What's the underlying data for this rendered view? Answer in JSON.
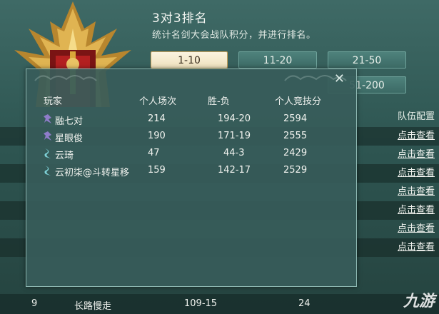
{
  "header": {
    "title": "3对3排名",
    "subtitle": "统计名剑大会战队积分，并进行排名。"
  },
  "range_tabs": [
    {
      "label": "1-10",
      "active": true
    },
    {
      "label": "11-20",
      "active": false
    },
    {
      "label": "21-50",
      "active": false
    },
    {
      "label": "51-200",
      "active": false
    }
  ],
  "background_list": {
    "column_label": "队伍配置",
    "link_label": "点击查看",
    "bottom_row": {
      "rank": "9",
      "team": "长路慢走",
      "record": "109-15",
      "score": "24"
    }
  },
  "popup": {
    "columns": [
      "玩家",
      "个人场次",
      "胜-负",
      "个人竞技分"
    ],
    "rows": [
      {
        "icon": "class-emblem-purple",
        "name": "融七对",
        "matches": "214",
        "record": "194-20",
        "score": "2594"
      },
      {
        "icon": "class-emblem-purple",
        "name": "星眼俊",
        "matches": "190",
        "record": "171-19",
        "score": "2555"
      },
      {
        "icon": "class-emblem-teal",
        "name": "云琦",
        "matches": "47",
        "record": "44-3",
        "score": "2429"
      },
      {
        "icon": "class-emblem-teal",
        "name": "云初柒@斗转星移",
        "matches": "159",
        "record": "142-17",
        "score": "2529"
      }
    ],
    "close_icon": "close-icon"
  },
  "watermark": "九游",
  "colors": {
    "accent_gold": "#c9a25a",
    "panel": "#375c5a"
  }
}
